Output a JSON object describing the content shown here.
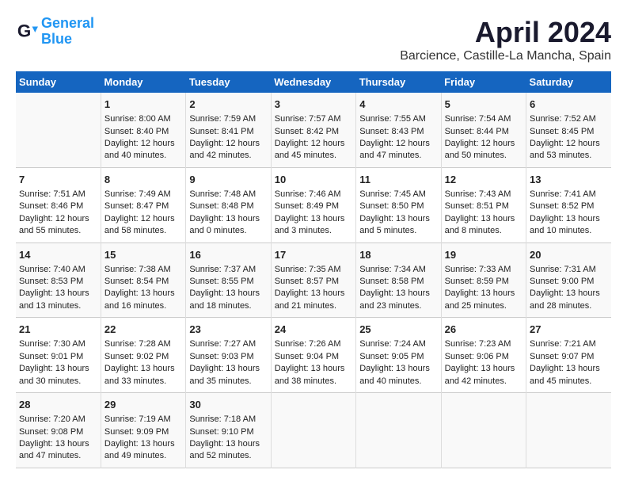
{
  "logo": {
    "line1": "General",
    "line2": "Blue"
  },
  "title": "April 2024",
  "subtitle": "Barcience, Castille-La Mancha, Spain",
  "days_header": [
    "Sunday",
    "Monday",
    "Tuesday",
    "Wednesday",
    "Thursday",
    "Friday",
    "Saturday"
  ],
  "weeks": [
    [
      {
        "num": "",
        "content": ""
      },
      {
        "num": "1",
        "content": "Sunrise: 8:00 AM\nSunset: 8:40 PM\nDaylight: 12 hours\nand 40 minutes."
      },
      {
        "num": "2",
        "content": "Sunrise: 7:59 AM\nSunset: 8:41 PM\nDaylight: 12 hours\nand 42 minutes."
      },
      {
        "num": "3",
        "content": "Sunrise: 7:57 AM\nSunset: 8:42 PM\nDaylight: 12 hours\nand 45 minutes."
      },
      {
        "num": "4",
        "content": "Sunrise: 7:55 AM\nSunset: 8:43 PM\nDaylight: 12 hours\nand 47 minutes."
      },
      {
        "num": "5",
        "content": "Sunrise: 7:54 AM\nSunset: 8:44 PM\nDaylight: 12 hours\nand 50 minutes."
      },
      {
        "num": "6",
        "content": "Sunrise: 7:52 AM\nSunset: 8:45 PM\nDaylight: 12 hours\nand 53 minutes."
      }
    ],
    [
      {
        "num": "7",
        "content": "Sunrise: 7:51 AM\nSunset: 8:46 PM\nDaylight: 12 hours\nand 55 minutes."
      },
      {
        "num": "8",
        "content": "Sunrise: 7:49 AM\nSunset: 8:47 PM\nDaylight: 12 hours\nand 58 minutes."
      },
      {
        "num": "9",
        "content": "Sunrise: 7:48 AM\nSunset: 8:48 PM\nDaylight: 13 hours\nand 0 minutes."
      },
      {
        "num": "10",
        "content": "Sunrise: 7:46 AM\nSunset: 8:49 PM\nDaylight: 13 hours\nand 3 minutes."
      },
      {
        "num": "11",
        "content": "Sunrise: 7:45 AM\nSunset: 8:50 PM\nDaylight: 13 hours\nand 5 minutes."
      },
      {
        "num": "12",
        "content": "Sunrise: 7:43 AM\nSunset: 8:51 PM\nDaylight: 13 hours\nand 8 minutes."
      },
      {
        "num": "13",
        "content": "Sunrise: 7:41 AM\nSunset: 8:52 PM\nDaylight: 13 hours\nand 10 minutes."
      }
    ],
    [
      {
        "num": "14",
        "content": "Sunrise: 7:40 AM\nSunset: 8:53 PM\nDaylight: 13 hours\nand 13 minutes."
      },
      {
        "num": "15",
        "content": "Sunrise: 7:38 AM\nSunset: 8:54 PM\nDaylight: 13 hours\nand 16 minutes."
      },
      {
        "num": "16",
        "content": "Sunrise: 7:37 AM\nSunset: 8:55 PM\nDaylight: 13 hours\nand 18 minutes."
      },
      {
        "num": "17",
        "content": "Sunrise: 7:35 AM\nSunset: 8:57 PM\nDaylight: 13 hours\nand 21 minutes."
      },
      {
        "num": "18",
        "content": "Sunrise: 7:34 AM\nSunset: 8:58 PM\nDaylight: 13 hours\nand 23 minutes."
      },
      {
        "num": "19",
        "content": "Sunrise: 7:33 AM\nSunset: 8:59 PM\nDaylight: 13 hours\nand 25 minutes."
      },
      {
        "num": "20",
        "content": "Sunrise: 7:31 AM\nSunset: 9:00 PM\nDaylight: 13 hours\nand 28 minutes."
      }
    ],
    [
      {
        "num": "21",
        "content": "Sunrise: 7:30 AM\nSunset: 9:01 PM\nDaylight: 13 hours\nand 30 minutes."
      },
      {
        "num": "22",
        "content": "Sunrise: 7:28 AM\nSunset: 9:02 PM\nDaylight: 13 hours\nand 33 minutes."
      },
      {
        "num": "23",
        "content": "Sunrise: 7:27 AM\nSunset: 9:03 PM\nDaylight: 13 hours\nand 35 minutes."
      },
      {
        "num": "24",
        "content": "Sunrise: 7:26 AM\nSunset: 9:04 PM\nDaylight: 13 hours\nand 38 minutes."
      },
      {
        "num": "25",
        "content": "Sunrise: 7:24 AM\nSunset: 9:05 PM\nDaylight: 13 hours\nand 40 minutes."
      },
      {
        "num": "26",
        "content": "Sunrise: 7:23 AM\nSunset: 9:06 PM\nDaylight: 13 hours\nand 42 minutes."
      },
      {
        "num": "27",
        "content": "Sunrise: 7:21 AM\nSunset: 9:07 PM\nDaylight: 13 hours\nand 45 minutes."
      }
    ],
    [
      {
        "num": "28",
        "content": "Sunrise: 7:20 AM\nSunset: 9:08 PM\nDaylight: 13 hours\nand 47 minutes."
      },
      {
        "num": "29",
        "content": "Sunrise: 7:19 AM\nSunset: 9:09 PM\nDaylight: 13 hours\nand 49 minutes."
      },
      {
        "num": "30",
        "content": "Sunrise: 7:18 AM\nSunset: 9:10 PM\nDaylight: 13 hours\nand 52 minutes."
      },
      {
        "num": "",
        "content": ""
      },
      {
        "num": "",
        "content": ""
      },
      {
        "num": "",
        "content": ""
      },
      {
        "num": "",
        "content": ""
      }
    ]
  ]
}
